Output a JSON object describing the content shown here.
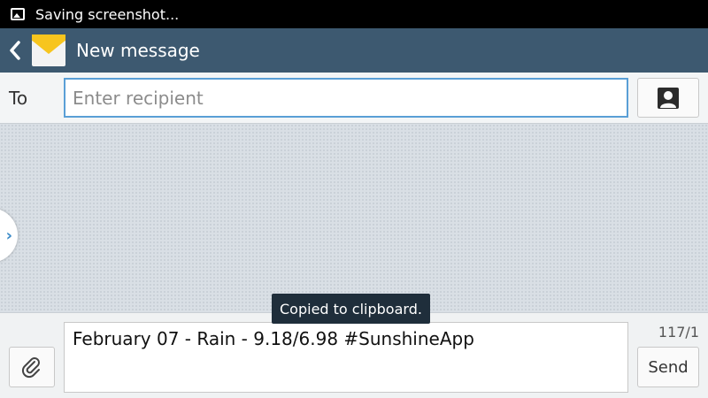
{
  "status_bar": {
    "text": "Saving screenshot...",
    "icon": "image-icon"
  },
  "action_bar": {
    "title": "New message",
    "back_icon": "chevron-left-icon",
    "app_icon": "envelope-icon"
  },
  "recipient": {
    "label": "To",
    "placeholder": "Enter recipient",
    "value": "",
    "contact_icon": "contact-icon"
  },
  "conversation": {
    "handle_icon": "chevron-right-icon"
  },
  "compose": {
    "message": "February 07 - Rain - 9.18/6.98 #SunshineApp",
    "char_counter": "117/1",
    "send_label": "Send",
    "attach_icon": "paperclip-icon"
  },
  "toast": {
    "text": "Copied to clipboard."
  },
  "colors": {
    "action_bar": "#3d5970",
    "status_bar": "#000000",
    "input_focus": "#5a9fd6",
    "toast": "#1f2e3b",
    "envelope_flap": "#f7c51e"
  }
}
